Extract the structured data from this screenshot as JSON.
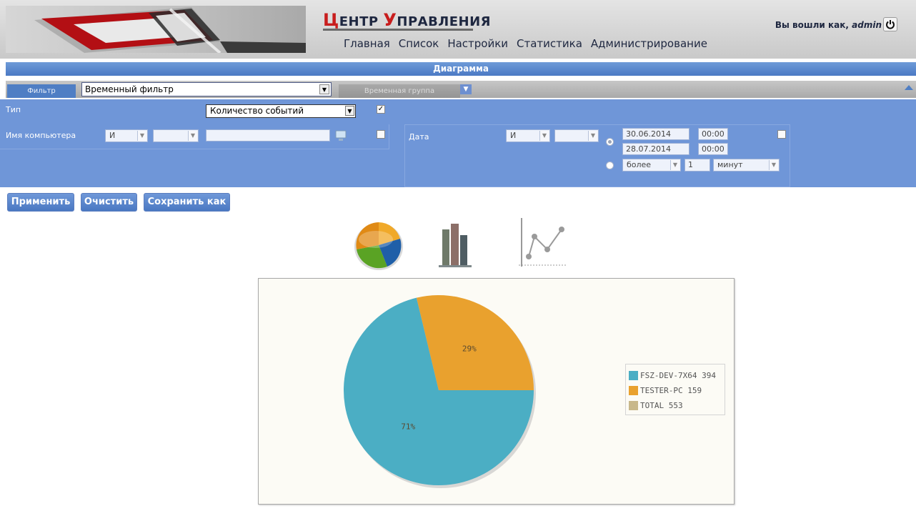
{
  "header": {
    "brand_cap1": "Ц",
    "brand_rest1": "ЕНТР ",
    "brand_cap2": "У",
    "brand_rest2": "ПРАВЛЕНИЯ",
    "nav": [
      "Главная",
      "Список",
      "Настройки",
      "Статистика",
      "Администрирование"
    ],
    "user_prefix": "Вы вошли как,",
    "user_name": "admin",
    "power_icon": "power-icon"
  },
  "section_title": "Диаграмма",
  "tabs": {
    "filter_label": "Фильтр",
    "filter_select_value": "Временный фильтр",
    "time_group_label": "Временная группа"
  },
  "filter": {
    "type_label": "Тип",
    "type_value": "Количество событий",
    "type_checked": true,
    "computer_label": "Имя компьютера",
    "computer_op1": "И",
    "computer_op2": "",
    "computer_value": "",
    "date_label": "Дата",
    "date_op1": "И",
    "date_op2": "",
    "date_from": "30.06.2014",
    "time_from": "00:00",
    "date_to": "28.07.2014",
    "time_to": "00:00",
    "relative_cmp": "более",
    "relative_num": "1",
    "relative_unit": "минут"
  },
  "actions": {
    "apply": "Применить",
    "clear": "Очистить",
    "save_as": "Сохранить как"
  },
  "colors": {
    "header_bar": "#4b79c4",
    "panel": "#6f96d8",
    "slice_blue": "#4baec4",
    "slice_orange": "#e9a12e",
    "slice_total": "#c8b88a"
  },
  "chart_data": {
    "type": "pie",
    "slices": [
      {
        "label": "FSZ-DEV-7X64",
        "value": 394,
        "percent": "71%",
        "color": "#4baec4"
      },
      {
        "label": "TESTER-PC",
        "value": 159,
        "percent": "29%",
        "color": "#e9a12e"
      }
    ],
    "legend": [
      {
        "label": "FSZ-DEV-7X64 394",
        "color": "#4baec4"
      },
      {
        "label": "TESTER-PC 159",
        "color": "#e9a12e"
      },
      {
        "label": "TOTAL 553",
        "color": "#c8b88a"
      }
    ],
    "legend_placement": "right"
  }
}
